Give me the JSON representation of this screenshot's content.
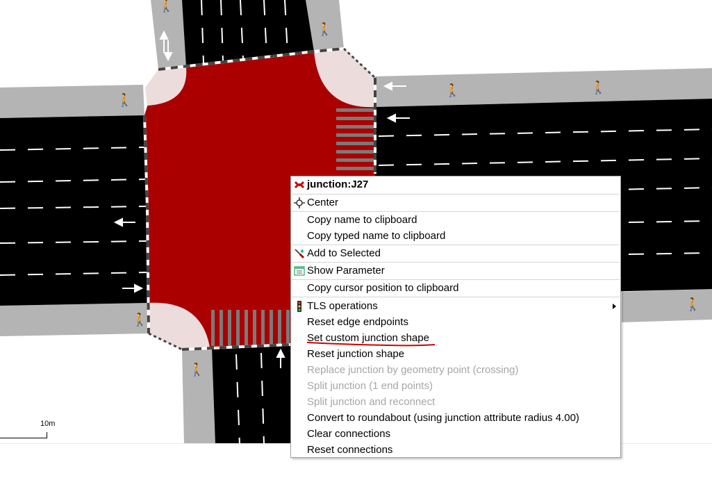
{
  "scale": {
    "label": "10m"
  },
  "menu": {
    "title": "junction:J27",
    "items": [
      {
        "label": "Center",
        "icon": "center-icon",
        "enabled": true
      },
      {
        "label": "Copy name to clipboard",
        "enabled": true
      },
      {
        "label": "Copy typed name to clipboard",
        "enabled": true
      },
      {
        "label": "Add to Selected",
        "icon": "add-selected-icon",
        "enabled": true
      },
      {
        "label": "Show Parameter",
        "icon": "parameter-icon",
        "enabled": true
      },
      {
        "label": "Copy cursor position to clipboard",
        "enabled": true
      },
      {
        "label": "TLS operations",
        "icon": "traffic-light-icon",
        "enabled": true,
        "submenu": true
      },
      {
        "label": "Reset edge endpoints",
        "enabled": true
      },
      {
        "label": "Set custom junction shape",
        "enabled": true,
        "highlighted_by_annotation": true
      },
      {
        "label": "Reset junction shape",
        "enabled": true
      },
      {
        "label": "Replace junction by geometry point (crossing)",
        "enabled": false
      },
      {
        "label": "Split junction (1 end points)",
        "enabled": false
      },
      {
        "label": "Split junction and reconnect",
        "enabled": false
      },
      {
        "label": "Convert to roundabout (using junction attribute radius 4.00)",
        "enabled": true
      },
      {
        "label": "Clear connections",
        "enabled": true
      },
      {
        "label": "Reset connections",
        "enabled": true
      }
    ]
  },
  "colors": {
    "junction": "#aa0000",
    "road": "#000000",
    "sidewalk": "#b4b4b4",
    "corner": "#ecdcdc",
    "annotation": "#cc0000"
  }
}
